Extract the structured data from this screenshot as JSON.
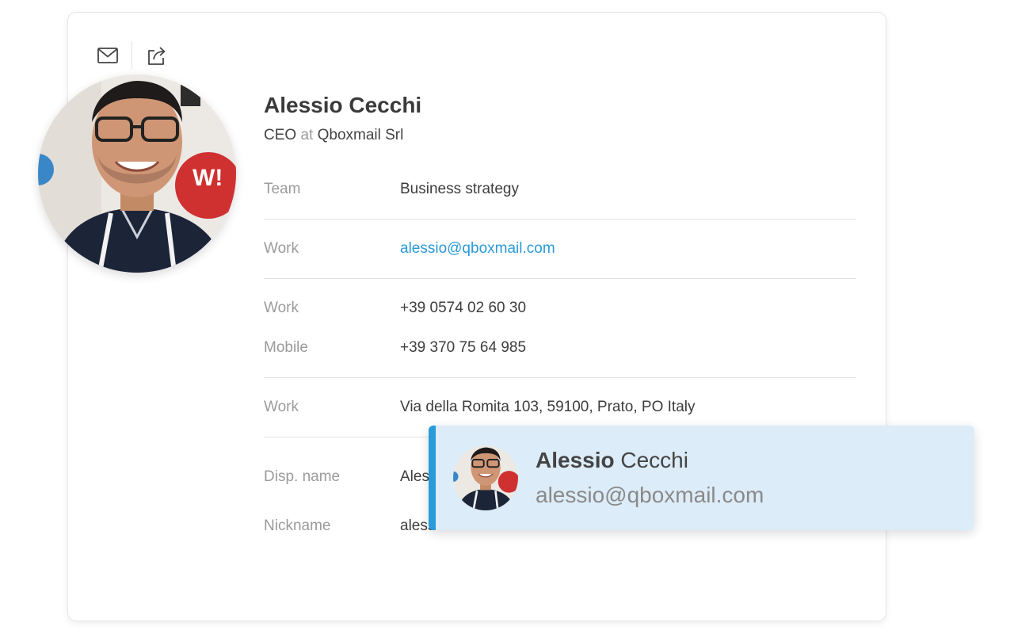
{
  "toolbar": {
    "mail_icon": "envelope-icon",
    "share_icon": "share-icon"
  },
  "contact": {
    "name": "Alessio Cecchi",
    "role": "CEO",
    "at": "at",
    "company": "Qboxmail Srl"
  },
  "fields": {
    "team": {
      "label": "Team",
      "value": "Business strategy"
    },
    "email": {
      "label": "Work",
      "value": "alessio@qboxmail.com"
    },
    "phone_work": {
      "label": "Work",
      "value": "+39 0574 02 60 30"
    },
    "phone_mobile": {
      "label": "Mobile",
      "value": "+39 370 75 64 985"
    },
    "address": {
      "label": "Work",
      "value": "Via della Romita 103, 59100, Prato, PO Italy"
    },
    "display_name": {
      "label": "Disp. name",
      "value": "Ales"
    },
    "nickname": {
      "label": "Nickname",
      "value": "aless"
    }
  },
  "popup": {
    "first_name": "Alessio",
    "last_name": "Cecchi",
    "email": "alessio@qboxmail.com"
  },
  "colors": {
    "accent": "#2a9ad8",
    "popup_bg": "#dcecf8"
  }
}
